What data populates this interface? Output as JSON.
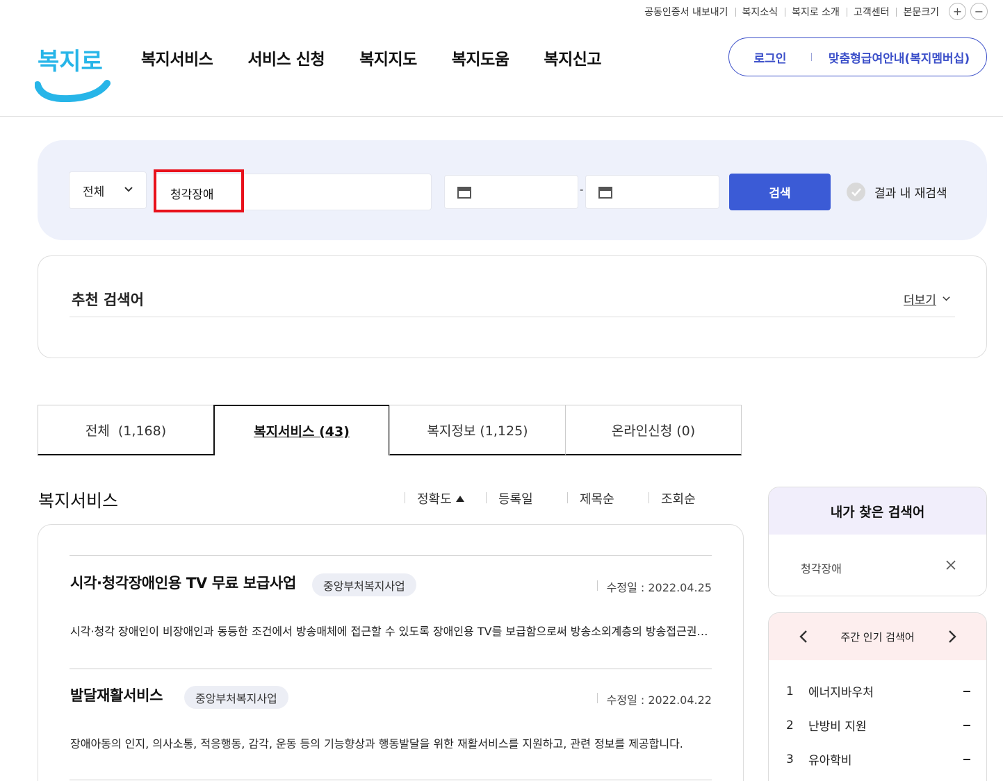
{
  "utility": {
    "cert_export": "공동인증서 내보내기",
    "news": "복지소식",
    "about": "복지로 소개",
    "support": "고객센터",
    "font_size": "본문크기",
    "font_plus": "+",
    "font_minus": "−"
  },
  "logo_text": "복지로",
  "gnb": [
    "복지서비스",
    "서비스 신청",
    "복지지도",
    "복지도움",
    "복지신고"
  ],
  "login": {
    "login_label": "로그인",
    "member_label": "맞춤형급여안내(복지멤버십)"
  },
  "search": {
    "category": "전체",
    "keyword": "청각장애",
    "date_from": "",
    "date_to": "",
    "dash": "-",
    "button": "검색",
    "research_label": "결과 내 재검색"
  },
  "recommend": {
    "title": "추천 검색어",
    "more": "더보기"
  },
  "tabs": [
    "전체  (1,168)",
    "복지서비스 (43)",
    "복지정보 (1,125)",
    "온라인신청 (0)"
  ],
  "list": {
    "title": "복지서비스",
    "sorts": [
      "정확도",
      "등록일",
      "제목순",
      "조회순"
    ],
    "items": [
      {
        "title": "시각·청각장애인용 TV 무료 보급사업",
        "badge": "중앙부처복지사업",
        "date": "수정일 : 2022.04.25",
        "desc": "시각·청각 장애인이 비장애인과 동등한 조건에서 방송매체에 접근할 수 있도록 장애인용 TV를 보급함으로써 방송소외계층의 방송접근권을 보장합니다."
      },
      {
        "title": "발달재활서비스",
        "badge": "중앙부처복지사업",
        "date": "수정일 : 2022.04.22",
        "desc": "장애아동의 인지, 의사소통, 적응행동, 감각, 운동 등의 기능향상과 행동발달을 위한 재활서비스를 지원하고, 관련 정보를 제공합니다."
      }
    ]
  },
  "my_search": {
    "title": "내가 찾은 검색어",
    "items": [
      "청각장애"
    ]
  },
  "popular": {
    "title": "주간 인기 검색어",
    "items": [
      {
        "rank": "1",
        "name": "에너지바우처"
      },
      {
        "rank": "2",
        "name": "난방비 지원"
      },
      {
        "rank": "3",
        "name": "유아학비"
      }
    ]
  }
}
